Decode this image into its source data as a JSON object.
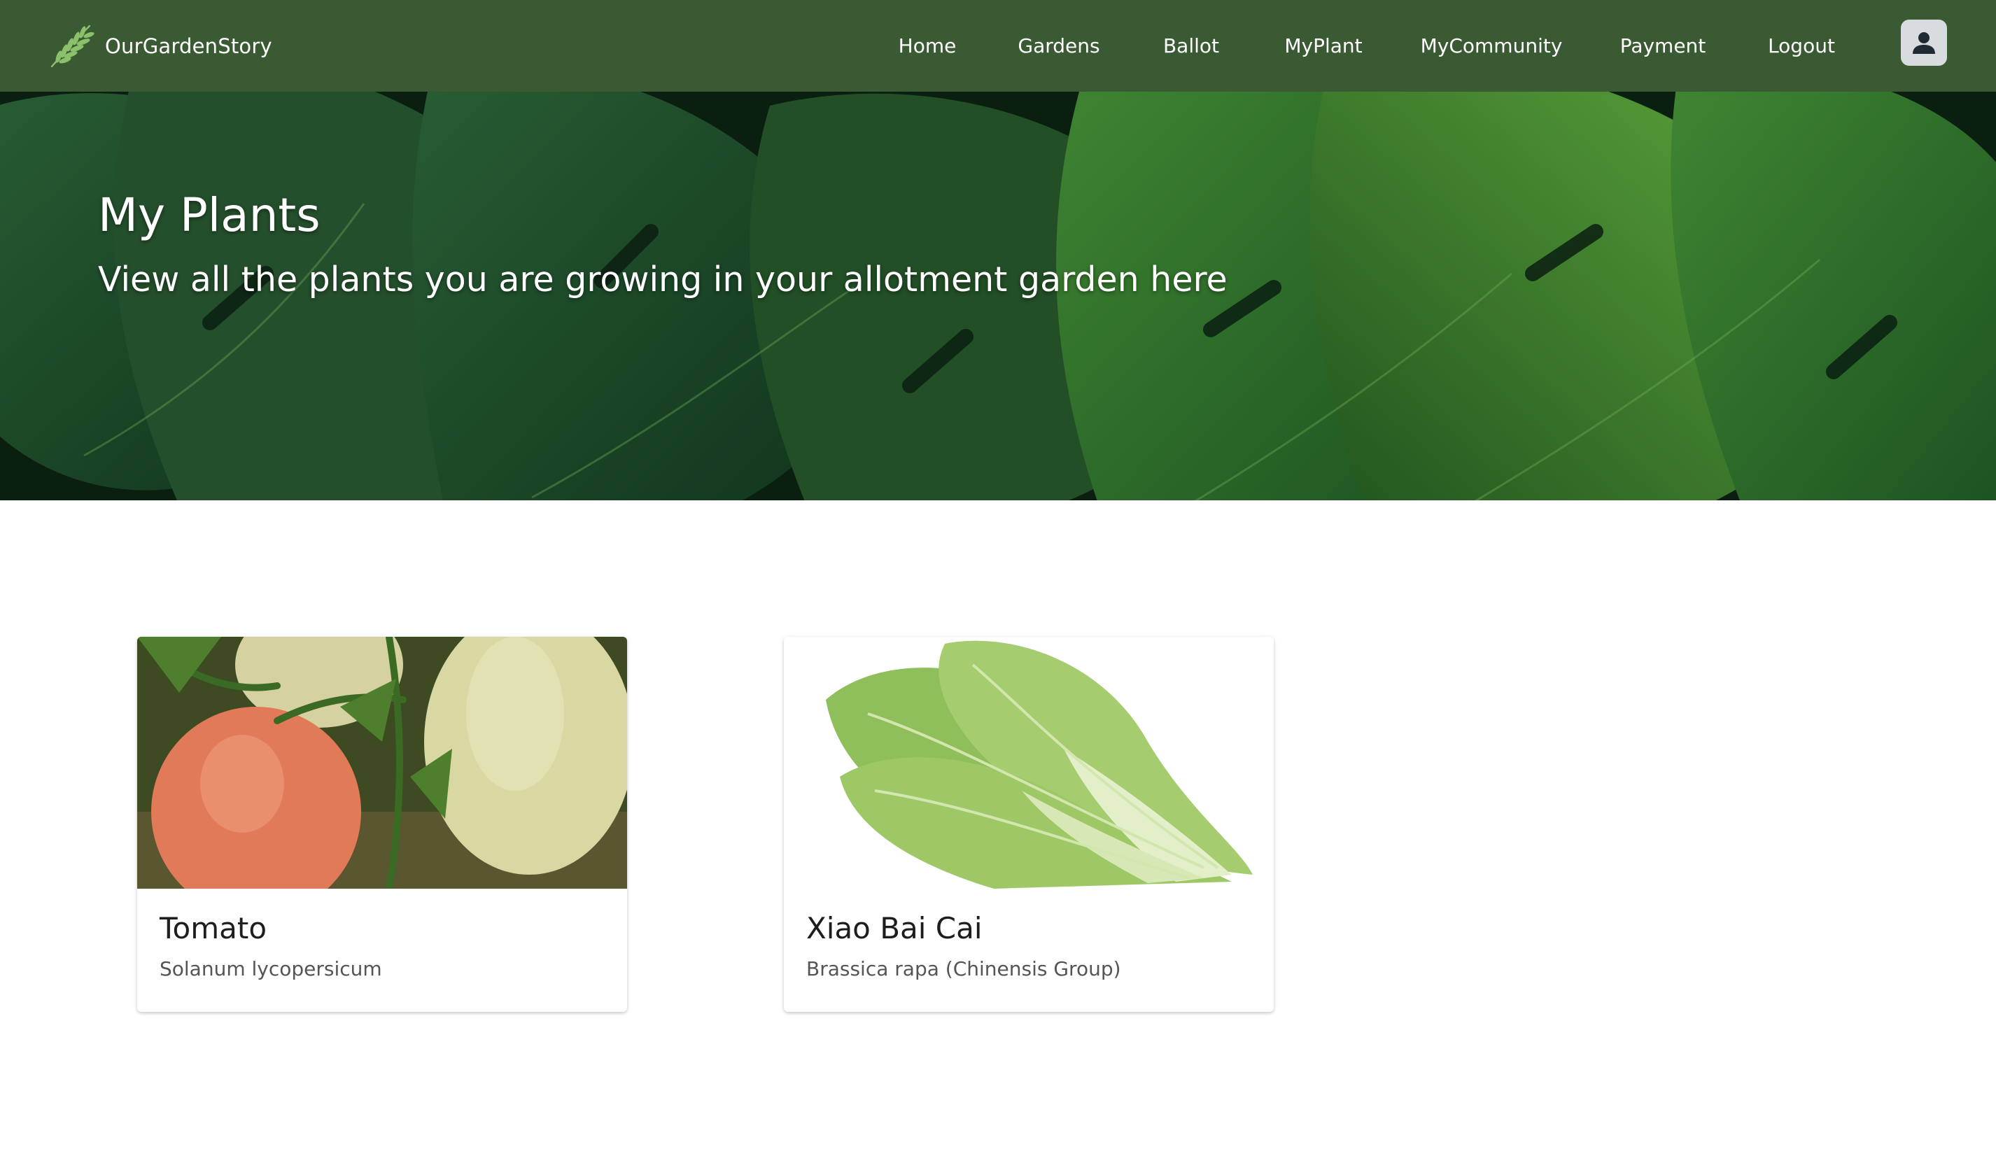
{
  "navbar": {
    "brand_name": "OurGardenStory",
    "links": [
      {
        "label": "Home"
      },
      {
        "label": "Gardens"
      },
      {
        "label": "Ballot"
      },
      {
        "label": "MyPlant"
      },
      {
        "label": "MyCommunity"
      },
      {
        "label": "Payment"
      },
      {
        "label": "Logout"
      }
    ],
    "avatar_icon": "account-circle-icon",
    "background_color": "#3a5a34"
  },
  "hero": {
    "title": "My Plants",
    "subtitle": "View all the plants you are growing in your allotment garden here"
  },
  "plants": [
    {
      "name": "Tomato",
      "scientific_name": "Solanum lycopersicum"
    },
    {
      "name": "Xiao Bai Cai",
      "scientific_name": "Brassica rapa (Chinensis Group)"
    }
  ]
}
